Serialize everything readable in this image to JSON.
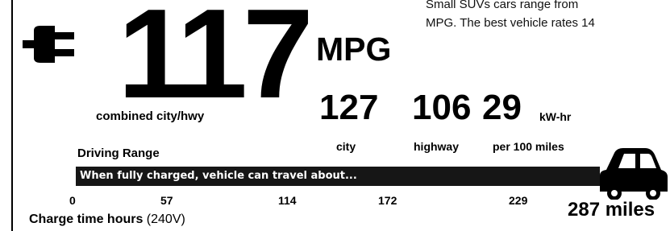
{
  "efficiency": {
    "combined_mpg": "117",
    "unit": "MPG",
    "combined_label": "combined city/hwy",
    "city_mpg": "127",
    "city_label": "city",
    "highway_mpg": "106",
    "highway_label": "highway",
    "kwh": "29",
    "kwh_unit": "kW-hr",
    "kwh_label": "per 100 miles"
  },
  "description": {
    "line1": "Small  SUVs  cars  range  from",
    "line2": "MPG. The best vehicle rates 14"
  },
  "range": {
    "title": "Driving Range",
    "bar_text": "When fully charged, vehicle can travel about...",
    "ticks": [
      "0",
      "57",
      "114",
      "172",
      "229"
    ],
    "total": "287 miles"
  },
  "charge": {
    "label_bold": "Charge time  hours",
    "label_suffix": " (240V)"
  },
  "icons": {
    "plug": "plug-icon",
    "car": "car-icon"
  }
}
